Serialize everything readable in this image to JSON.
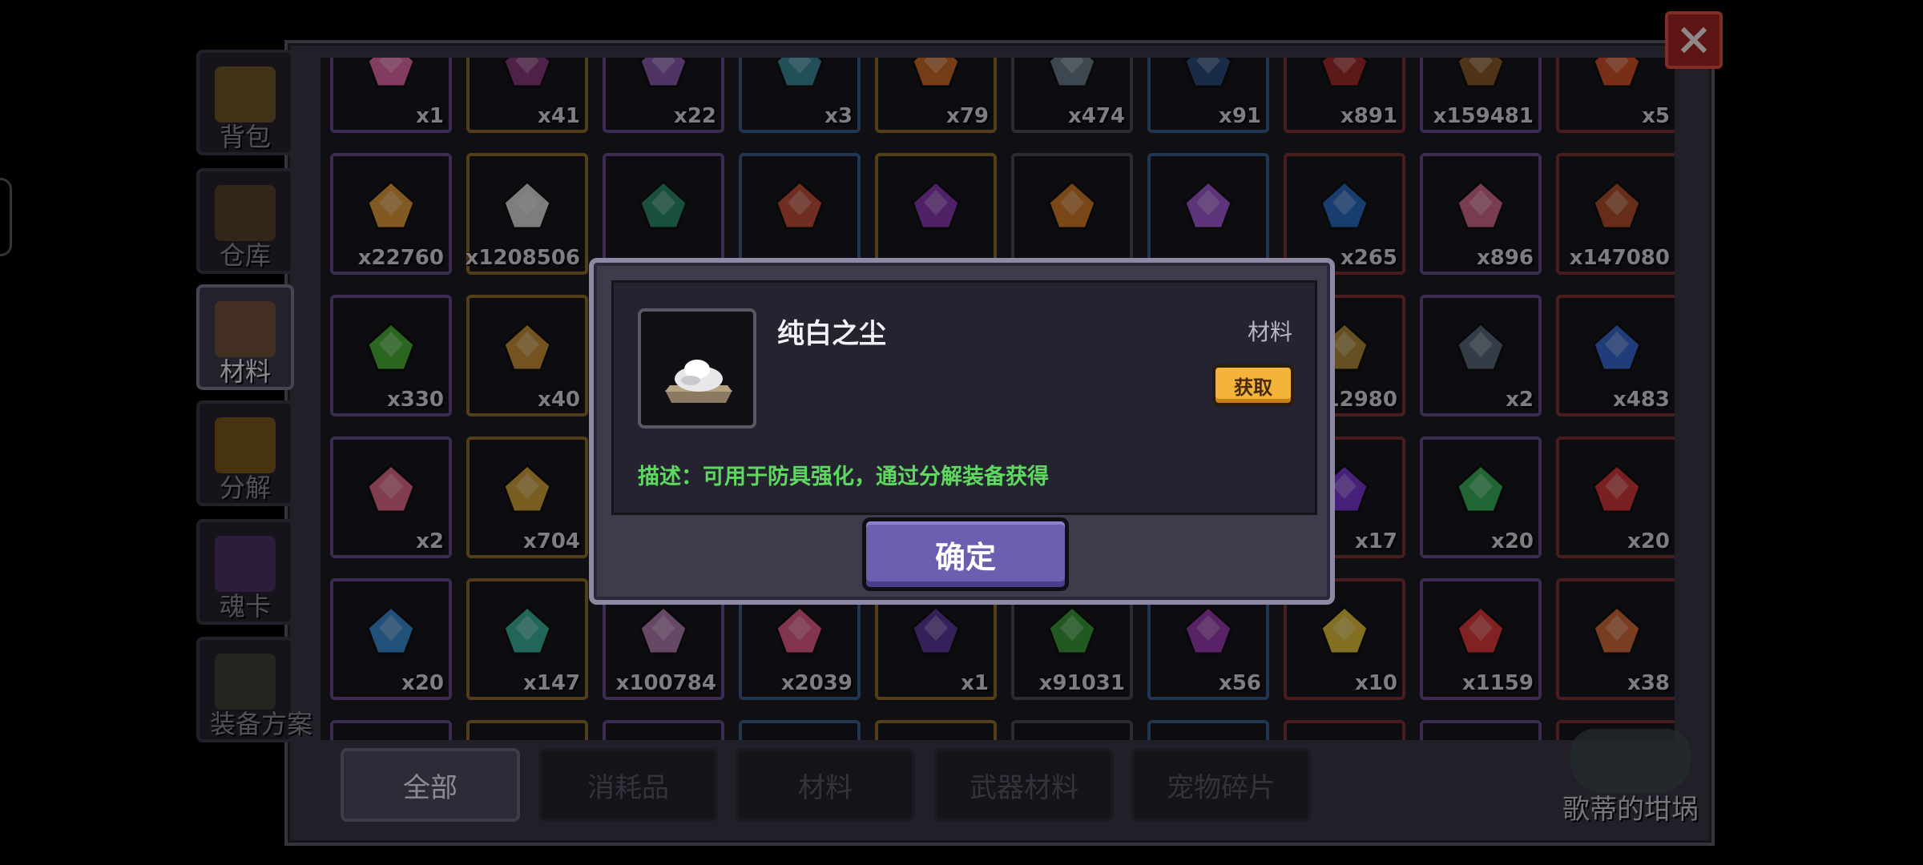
{
  "left_tabs": [
    {
      "label": "背包",
      "icon": "backpack-icon",
      "color": "#8a6a2a"
    },
    {
      "label": "仓库",
      "icon": "warehouse-chest-icon",
      "color": "#6b4a2a"
    },
    {
      "label": "材料",
      "icon": "materials-bag-icon",
      "color": "#8a5a3a"
    },
    {
      "label": "分解",
      "icon": "decompose-pot-icon",
      "color": "#9a6a18"
    },
    {
      "label": "魂卡",
      "icon": "soul-card-icon",
      "color": "#5a3a7a"
    },
    {
      "label": "装备方案",
      "icon": "armor-set-icon",
      "color": "#4a4a3a"
    }
  ],
  "items": [
    {
      "qty": "x1",
      "color": "#e06aa8"
    },
    {
      "qty": "x41",
      "color": "#8a3a7a"
    },
    {
      "qty": "x22",
      "color": "#8a5ab0"
    },
    {
      "qty": "x3",
      "color": "#3a8a9a"
    },
    {
      "qty": "x79",
      "color": "#c86a2a"
    },
    {
      "qty": "x474",
      "color": "#6a7a8a"
    },
    {
      "qty": "x91",
      "color": "#2a4a7a"
    },
    {
      "qty": "x891",
      "color": "#a02a2a"
    },
    {
      "qty": "x159481",
      "color": "#8a5a2a"
    },
    {
      "qty": "x5",
      "color": "#d0502a"
    },
    {
      "qty": "x22760",
      "color": "#e09a3a"
    },
    {
      "qty": "x1208506",
      "color": "#d8d8d8"
    },
    {
      "qty": "",
      "color": "#2a8a6a"
    },
    {
      "qty": "",
      "color": "#c0503a"
    },
    {
      "qty": "",
      "color": "#8a3ab0"
    },
    {
      "qty": "",
      "color": "#d07a2a"
    },
    {
      "qty": "",
      "color": "#a05ad0"
    },
    {
      "qty": "x265",
      "color": "#2a6ac0"
    },
    {
      "qty": "x896",
      "color": "#d06a8a"
    },
    {
      "qty": "x147080",
      "color": "#b0502a"
    },
    {
      "qty": "x330",
      "color": "#4ab03a"
    },
    {
      "qty": "x40",
      "color": "#c8903a"
    },
    {
      "qty": "",
      "color": "#3a3a4a"
    },
    {
      "qty": "",
      "color": "#3a3a4a"
    },
    {
      "qty": "",
      "color": "#3a3a4a"
    },
    {
      "qty": "",
      "color": "#3a3a4a"
    },
    {
      "qty": "",
      "color": "#3a3a4a"
    },
    {
      "qty": "12980",
      "color": "#b08a3a"
    },
    {
      "qty": "x2",
      "color": "#5a6a7a"
    },
    {
      "qty": "x483",
      "color": "#3a6ad0"
    },
    {
      "qty": "x2",
      "color": "#e06a8a"
    },
    {
      "qty": "x704",
      "color": "#d0a03a"
    },
    {
      "qty": "",
      "color": "#3a3a4a"
    },
    {
      "qty": "",
      "color": "#3a3a4a"
    },
    {
      "qty": "",
      "color": "#3a3a4a"
    },
    {
      "qty": "",
      "color": "#3a3a4a"
    },
    {
      "qty": "",
      "color": "#3a3a4a"
    },
    {
      "qty": "x17",
      "color": "#7a3ad0"
    },
    {
      "qty": "x20",
      "color": "#3ab05a"
    },
    {
      "qty": "x20",
      "color": "#d03a3a"
    },
    {
      "qty": "x20",
      "color": "#3a8ad0"
    },
    {
      "qty": "x147",
      "color": "#3ab09a"
    },
    {
      "qty": "x100784",
      "color": "#b07ab0"
    },
    {
      "qty": "x2039",
      "color": "#e05a8a"
    },
    {
      "qty": "x1",
      "color": "#5a3a9a"
    },
    {
      "qty": "x91031",
      "color": "#3a9a3a"
    },
    {
      "qty": "x56",
      "color": "#9a3ab0"
    },
    {
      "qty": "x10",
      "color": "#e0c03a"
    },
    {
      "qty": "x1159",
      "color": "#e03a3a"
    },
    {
      "qty": "x38",
      "color": "#d06a3a"
    },
    {
      "qty": "",
      "color": "#3a3a4a"
    },
    {
      "qty": "",
      "color": "#3a3a4a"
    },
    {
      "qty": "",
      "color": "#3a3a4a"
    },
    {
      "qty": "",
      "color": "#3a3a4a"
    },
    {
      "qty": "",
      "color": "#3a3a4a"
    },
    {
      "qty": "",
      "color": "#3a3a4a"
    },
    {
      "qty": "",
      "color": "#3a3a4a"
    },
    {
      "qty": "",
      "color": "#3a3a4a"
    },
    {
      "qty": "",
      "color": "#3a3a4a"
    },
    {
      "qty": "",
      "color": "#3a3a4a"
    }
  ],
  "category_tabs": [
    {
      "label": "全部",
      "active": true
    },
    {
      "label": "消耗品",
      "active": false
    },
    {
      "label": "材料",
      "active": false
    },
    {
      "label": "武器材料",
      "active": false
    },
    {
      "label": "宠物碎片",
      "active": false
    }
  ],
  "cauldron": {
    "label": "歌蒂的坩埚",
    "icon": "cauldron-icon"
  },
  "close_icon": "close-x-icon",
  "dialog": {
    "item_name": "纯白之尘",
    "item_type": "材料",
    "get_button": "获取",
    "description": "描述：可用于防具强化，通过分解装备获得",
    "confirm_button": "确定",
    "item_icon": "white-dust-icon"
  }
}
